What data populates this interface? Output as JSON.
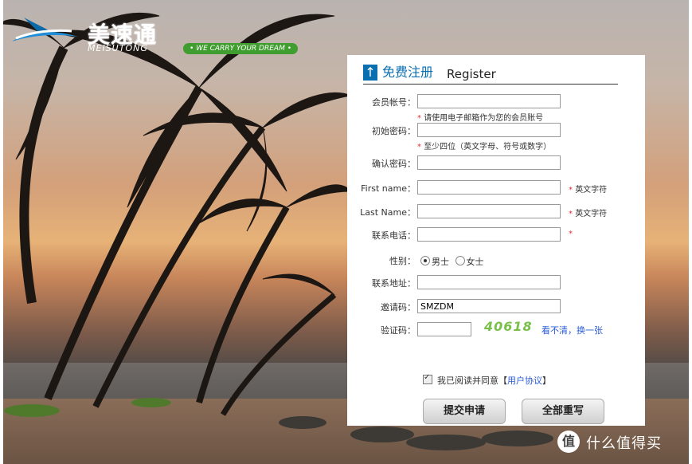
{
  "brand": {
    "name_cn": "美速通",
    "name_en": "MEISUTONG",
    "tagline": "• WE CARRY YOUR DREAM •"
  },
  "panel": {
    "title_cn": "免费注册",
    "title_en": "Register"
  },
  "form": {
    "account_label": "会员帐号：",
    "account_hint": "请使用电子邮箱作为您的会员账号",
    "password_label": "初始密码：",
    "password_hint": "至少四位（英文字母、符号或数字）",
    "confirm_label": "确认密码：",
    "first_name_label": "First name：",
    "first_name_note": "英文字符",
    "last_name_label": "Last Name：",
    "last_name_note": "英文字符",
    "phone_label": "联系电话：",
    "gender_label": "性别：",
    "gender_male": "男士",
    "gender_female": "女士",
    "address_label": "联系地址：",
    "invite_label": "邀请码：",
    "invite_value": "SMZDM",
    "captcha_label": "验证码：",
    "captcha_image_text": "40618",
    "captcha_refresh": "看不清，换一张",
    "required_mark": "*",
    "agree_text": "我已阅读并同意【",
    "agree_link": "用户协议",
    "agree_close": "】"
  },
  "buttons": {
    "submit": "提交申请",
    "reset": "全部重写"
  },
  "watermark": {
    "icon": "值",
    "text": "什么值得买"
  }
}
